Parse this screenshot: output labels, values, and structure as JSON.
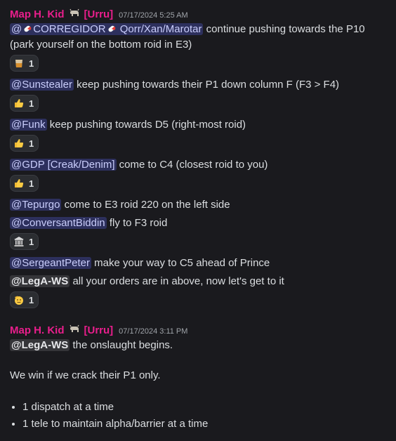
{
  "messages": [
    {
      "author": "Map H. Kid",
      "server_tag": "[Urru]",
      "timestamp": "07/17/2024 5:25 AM",
      "lines": [
        {
          "mention": "@",
          "mention_b": "CORREGIDOR",
          "mention_c": "Qorr/Xan/Marotar",
          "text": "continue pushing towards the P10 (park yourself on the bottom roid in E3)"
        }
      ],
      "blocks": [
        {
          "mention": "@Sunstealer",
          "text": "keep pushing towards their P1 down column F (F3 > F4)",
          "reaction": {
            "emoji": "thumbs-up",
            "count": "1"
          }
        },
        {
          "mention": "@Funk",
          "text": "keep pushing towards D5 (right-most roid)",
          "reaction": {
            "emoji": "thumbs-up",
            "count": "1"
          }
        },
        {
          "mention": "@GDP [Creak/Denim]",
          "text": "come to C4 (closest roid to you)",
          "reaction": {
            "emoji": "thumbs-up",
            "count": "1"
          }
        },
        {
          "mention": "@Tepurgo",
          "text": "come to E3 roid 220 on the left side"
        },
        {
          "mention": "@ConversantBiddin",
          "text": "fly to F3 roid",
          "reaction": {
            "emoji": "classical-building",
            "count": "1"
          }
        },
        {
          "mention": "@SergeantPeter",
          "text": "make your way to C5 ahead of Prince"
        },
        {
          "mention": "@LegA-WS",
          "text": "all your orders are in above, now let's get to it",
          "reaction": {
            "emoji": "saluting-face",
            "count": "1"
          }
        }
      ],
      "first_reaction": {
        "emoji": "tumbler-glass",
        "count": "1"
      }
    },
    {
      "author": "Map H. Kid",
      "server_tag": "[Urru]",
      "timestamp": "07/17/2024 3:11 PM",
      "mention": "@LegA-WS",
      "text": "the onslaught begins.",
      "paragraph": "We win if we crack their P1 only.",
      "bullets": [
        "1 dispatch at a time",
        "1 tele to maintain alpha/barrier at a time"
      ]
    }
  ],
  "colors": {
    "author": "#e91e8c",
    "mention_bg": "#3c3f8f",
    "background": "#1a1a1e"
  }
}
